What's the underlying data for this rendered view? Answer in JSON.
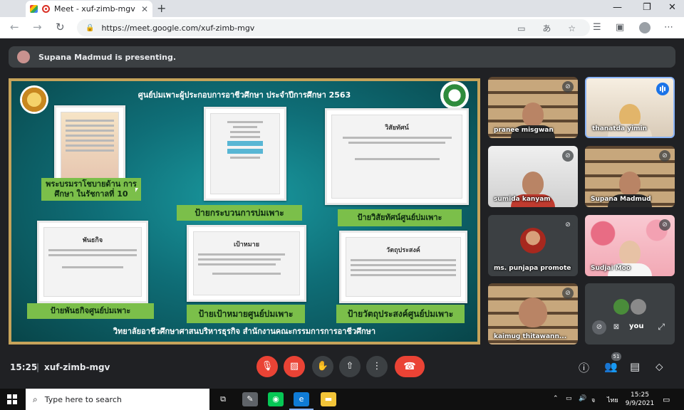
{
  "browser": {
    "tab_title": "Meet - xuf-zimb-mgv",
    "tab_close": "✕",
    "new_tab": "+",
    "url": "https://meet.google.com/xuf-zimb-mgv",
    "window_controls": {
      "minimize": "—",
      "restore": "❐",
      "close": "✕"
    }
  },
  "meet": {
    "presenting_text": "Supana Madmud is presenting.",
    "time": "15:25",
    "divider": "|",
    "meeting_code": "xuf-zimb-mgv",
    "participant_count": "51",
    "slide": {
      "title": "ศูนย์บ่มเพาะผู้ประกอบการอาชีวศึกษา  ประจำปีการศึกษา 2563",
      "footer": "วิทยาลัยอาชีวศึกษาศาสนบริหารธุรกิจ    สำนักงานคณะกรรมการการอาชีวศึกษา",
      "labels": {
        "policy": "พระบรมราโชบายด้าน การศึกษา ในรัชกาลที่ 10",
        "process": "ป้ายกระบวนการบ่มเพาะ",
        "vision": "ป้ายวิสัยทัศน์ศูนย์บ่มเพาะ",
        "mission": "ป้ายพันธกิจศูนย์บ่มเพาะ",
        "goal": "ป้ายเป้าหมายศูนย์บ่มเพาะ",
        "objective": "ป้ายวัตถุประสงค์ศูนย์บ่มเพาะ"
      },
      "card_headings": {
        "vision": "วิสัยทัศน์",
        "mission": "พันธกิจ",
        "goal": "เป้าหมาย",
        "objective": "วัตถุประสงค์"
      }
    },
    "participants": [
      {
        "name": "pranee misgwan"
      },
      {
        "name": "thanatda yimin"
      },
      {
        "name": "sumida kanyam"
      },
      {
        "name": "Supana Madmud"
      },
      {
        "name": "ms. punjapa promote"
      },
      {
        "name": "Sudjai Moo"
      },
      {
        "name": "kaimug thitawann..."
      },
      {
        "name": "you"
      }
    ]
  },
  "taskbar": {
    "search_placeholder": "Type here to search",
    "language": "ไทย",
    "time": "15:25",
    "date": "9/9/2021"
  },
  "colors": {
    "meet_bg": "#202124",
    "control_red": "#ea4335",
    "control_grey": "#3c4043",
    "slide_frame": "#c6a35a",
    "slide_label_green": "#7bbf4a",
    "speaking_blue": "#8ab4f8"
  },
  "icons": {
    "back": "back-arrow-icon",
    "forward": "forward-arrow-icon",
    "reload": "reload-icon",
    "lock": "lock-icon",
    "mic_off": "mic-off-icon",
    "camera_off": "camera-off-icon",
    "raise_hand": "hand-icon",
    "present": "present-screen-icon",
    "more": "more-options-icon",
    "hangup": "hangup-icon",
    "info": "info-icon",
    "people": "people-icon",
    "chat": "chat-icon",
    "activities": "activities-icon"
  }
}
